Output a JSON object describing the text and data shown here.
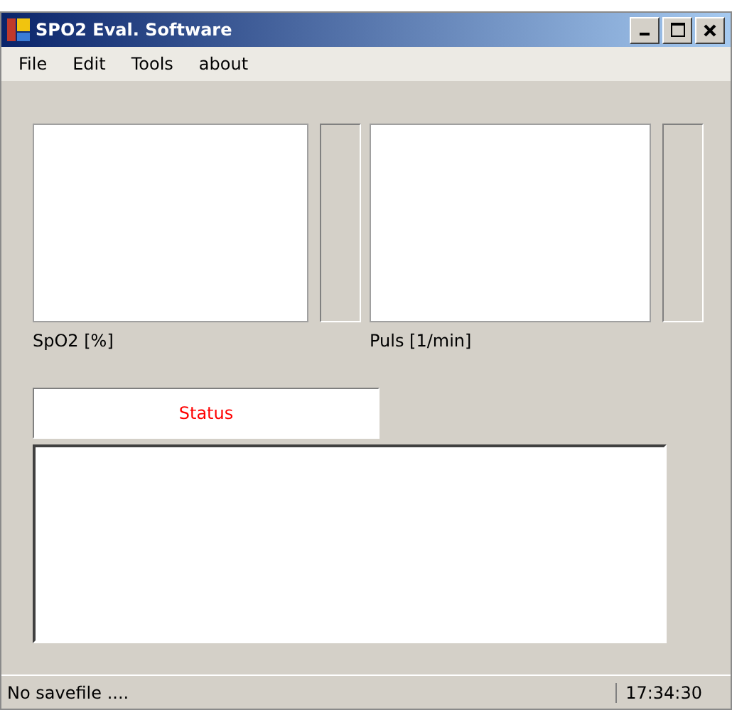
{
  "window": {
    "title": "SPO2 Eval. Software"
  },
  "menu": [
    "File",
    "Edit",
    "Tools",
    "about"
  ],
  "gauges": [
    {
      "label": "SpO2 [%]"
    },
    {
      "label": "Puls [1/min]"
    }
  ],
  "status_field": {
    "value": "Status"
  },
  "status_bar": {
    "message": "No savefile ....",
    "time": "17:34:30"
  }
}
